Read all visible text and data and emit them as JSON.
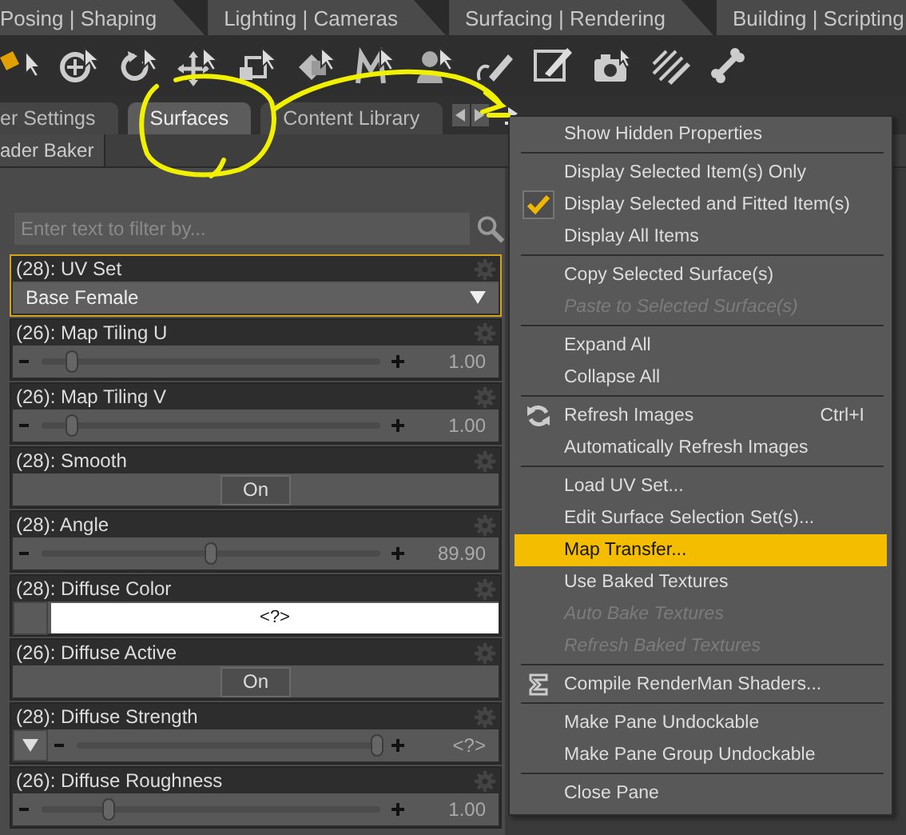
{
  "workspace_tabs": [
    {
      "label": "Posing | Shaping",
      "selected": false
    },
    {
      "label": "Lighting | Cameras",
      "selected": false
    },
    {
      "label": "Surfacing | Rendering",
      "selected": false
    },
    {
      "label": "Building | Scripting",
      "selected": false
    }
  ],
  "pane_tabs": [
    {
      "label": "er Settings",
      "selected": false
    },
    {
      "label": "Surfaces",
      "selected": true
    },
    {
      "label": "Content Library",
      "selected": false
    }
  ],
  "sub_tab": "ader Baker",
  "filter": {
    "placeholder": "Enter text to filter by..."
  },
  "properties": [
    {
      "kind": "dropdown",
      "label": "(28): UV Set",
      "selected": true,
      "value": "Base Female"
    },
    {
      "kind": "slider",
      "label": "(26): Map Tiling U",
      "selected": false,
      "level": 0.09,
      "reading": "1.00"
    },
    {
      "kind": "slider",
      "label": "(26): Map Tiling V",
      "selected": false,
      "level": 0.09,
      "reading": "1.00"
    },
    {
      "kind": "toggle",
      "label": "(28): Smooth",
      "selected": false,
      "value": "On"
    },
    {
      "kind": "slider",
      "label": "(28): Angle",
      "selected": false,
      "level": 0.5,
      "reading": "89.90"
    },
    {
      "kind": "color",
      "label": "(28): Diffuse Color",
      "selected": false,
      "value": "<?>"
    },
    {
      "kind": "toggle",
      "label": "(26): Diffuse Active",
      "selected": false,
      "value": "On"
    },
    {
      "kind": "slider",
      "label": "(28): Diffuse Strength",
      "selected": false,
      "menu_button": true,
      "level": 0.99,
      "reading": "<?>"
    },
    {
      "kind": "slider",
      "label": "(26): Diffuse Roughness",
      "selected": false,
      "level": 0.2,
      "reading": "1.00"
    }
  ],
  "menu": [
    {
      "kind": "item",
      "label": "Show Hidden Properties",
      "disabled": false,
      "checked": false,
      "selected": false
    },
    {
      "kind": "separator"
    },
    {
      "kind": "item",
      "label": "Display Selected Item(s) Only",
      "disabled": false,
      "checked": false,
      "selected": false
    },
    {
      "kind": "item",
      "label": "Display Selected and Fitted Item(s)",
      "disabled": false,
      "checked": true,
      "selected": false
    },
    {
      "kind": "item",
      "label": "Display All Items",
      "disabled": false,
      "checked": false,
      "selected": false
    },
    {
      "kind": "separator"
    },
    {
      "kind": "item",
      "label": "Copy Selected Surface(s)",
      "disabled": false,
      "checked": false,
      "selected": false
    },
    {
      "kind": "item",
      "label": "Paste to Selected Surface(s)",
      "disabled": true,
      "checked": false,
      "selected": false
    },
    {
      "kind": "separator"
    },
    {
      "kind": "item",
      "label": "Expand All",
      "disabled": false,
      "checked": false,
      "selected": false
    },
    {
      "kind": "item",
      "label": "Collapse All",
      "disabled": false,
      "checked": false,
      "selected": false
    },
    {
      "kind": "separator"
    },
    {
      "kind": "refresh",
      "label": "Refresh Images",
      "shortcut": "Ctrl+I",
      "disabled": false,
      "checked": false,
      "selected": false
    },
    {
      "kind": "item",
      "label": "Automatically Refresh Images",
      "disabled": false,
      "checked": false,
      "selected": false
    },
    {
      "kind": "separator"
    },
    {
      "kind": "item",
      "label": "Load UV Set...",
      "disabled": false,
      "checked": false,
      "selected": false
    },
    {
      "kind": "item",
      "label": "Edit Surface Selection Set(s)...",
      "disabled": false,
      "checked": false,
      "selected": false
    },
    {
      "kind": "item",
      "label": "Map Transfer...",
      "disabled": false,
      "checked": false,
      "selected": true
    },
    {
      "kind": "item",
      "label": "Use Baked Textures",
      "disabled": false,
      "checked": false,
      "selected": false
    },
    {
      "kind": "item",
      "label": "Auto Bake Textures",
      "disabled": true,
      "checked": false,
      "selected": false
    },
    {
      "kind": "item",
      "label": "Refresh Baked Textures",
      "disabled": true,
      "checked": false,
      "selected": false
    },
    {
      "kind": "separator"
    },
    {
      "kind": "compile",
      "label": "Compile RenderMan Shaders...",
      "disabled": false,
      "checked": false,
      "selected": false
    },
    {
      "kind": "separator"
    },
    {
      "kind": "item",
      "label": "Make Pane Undockable",
      "disabled": false,
      "checked": false,
      "selected": false
    },
    {
      "kind": "item",
      "label": "Make Pane Group Undockable",
      "disabled": false,
      "checked": false,
      "selected": false
    },
    {
      "kind": "separator"
    },
    {
      "kind": "item",
      "label": "Close Pane",
      "disabled": false,
      "checked": false,
      "selected": false
    }
  ]
}
